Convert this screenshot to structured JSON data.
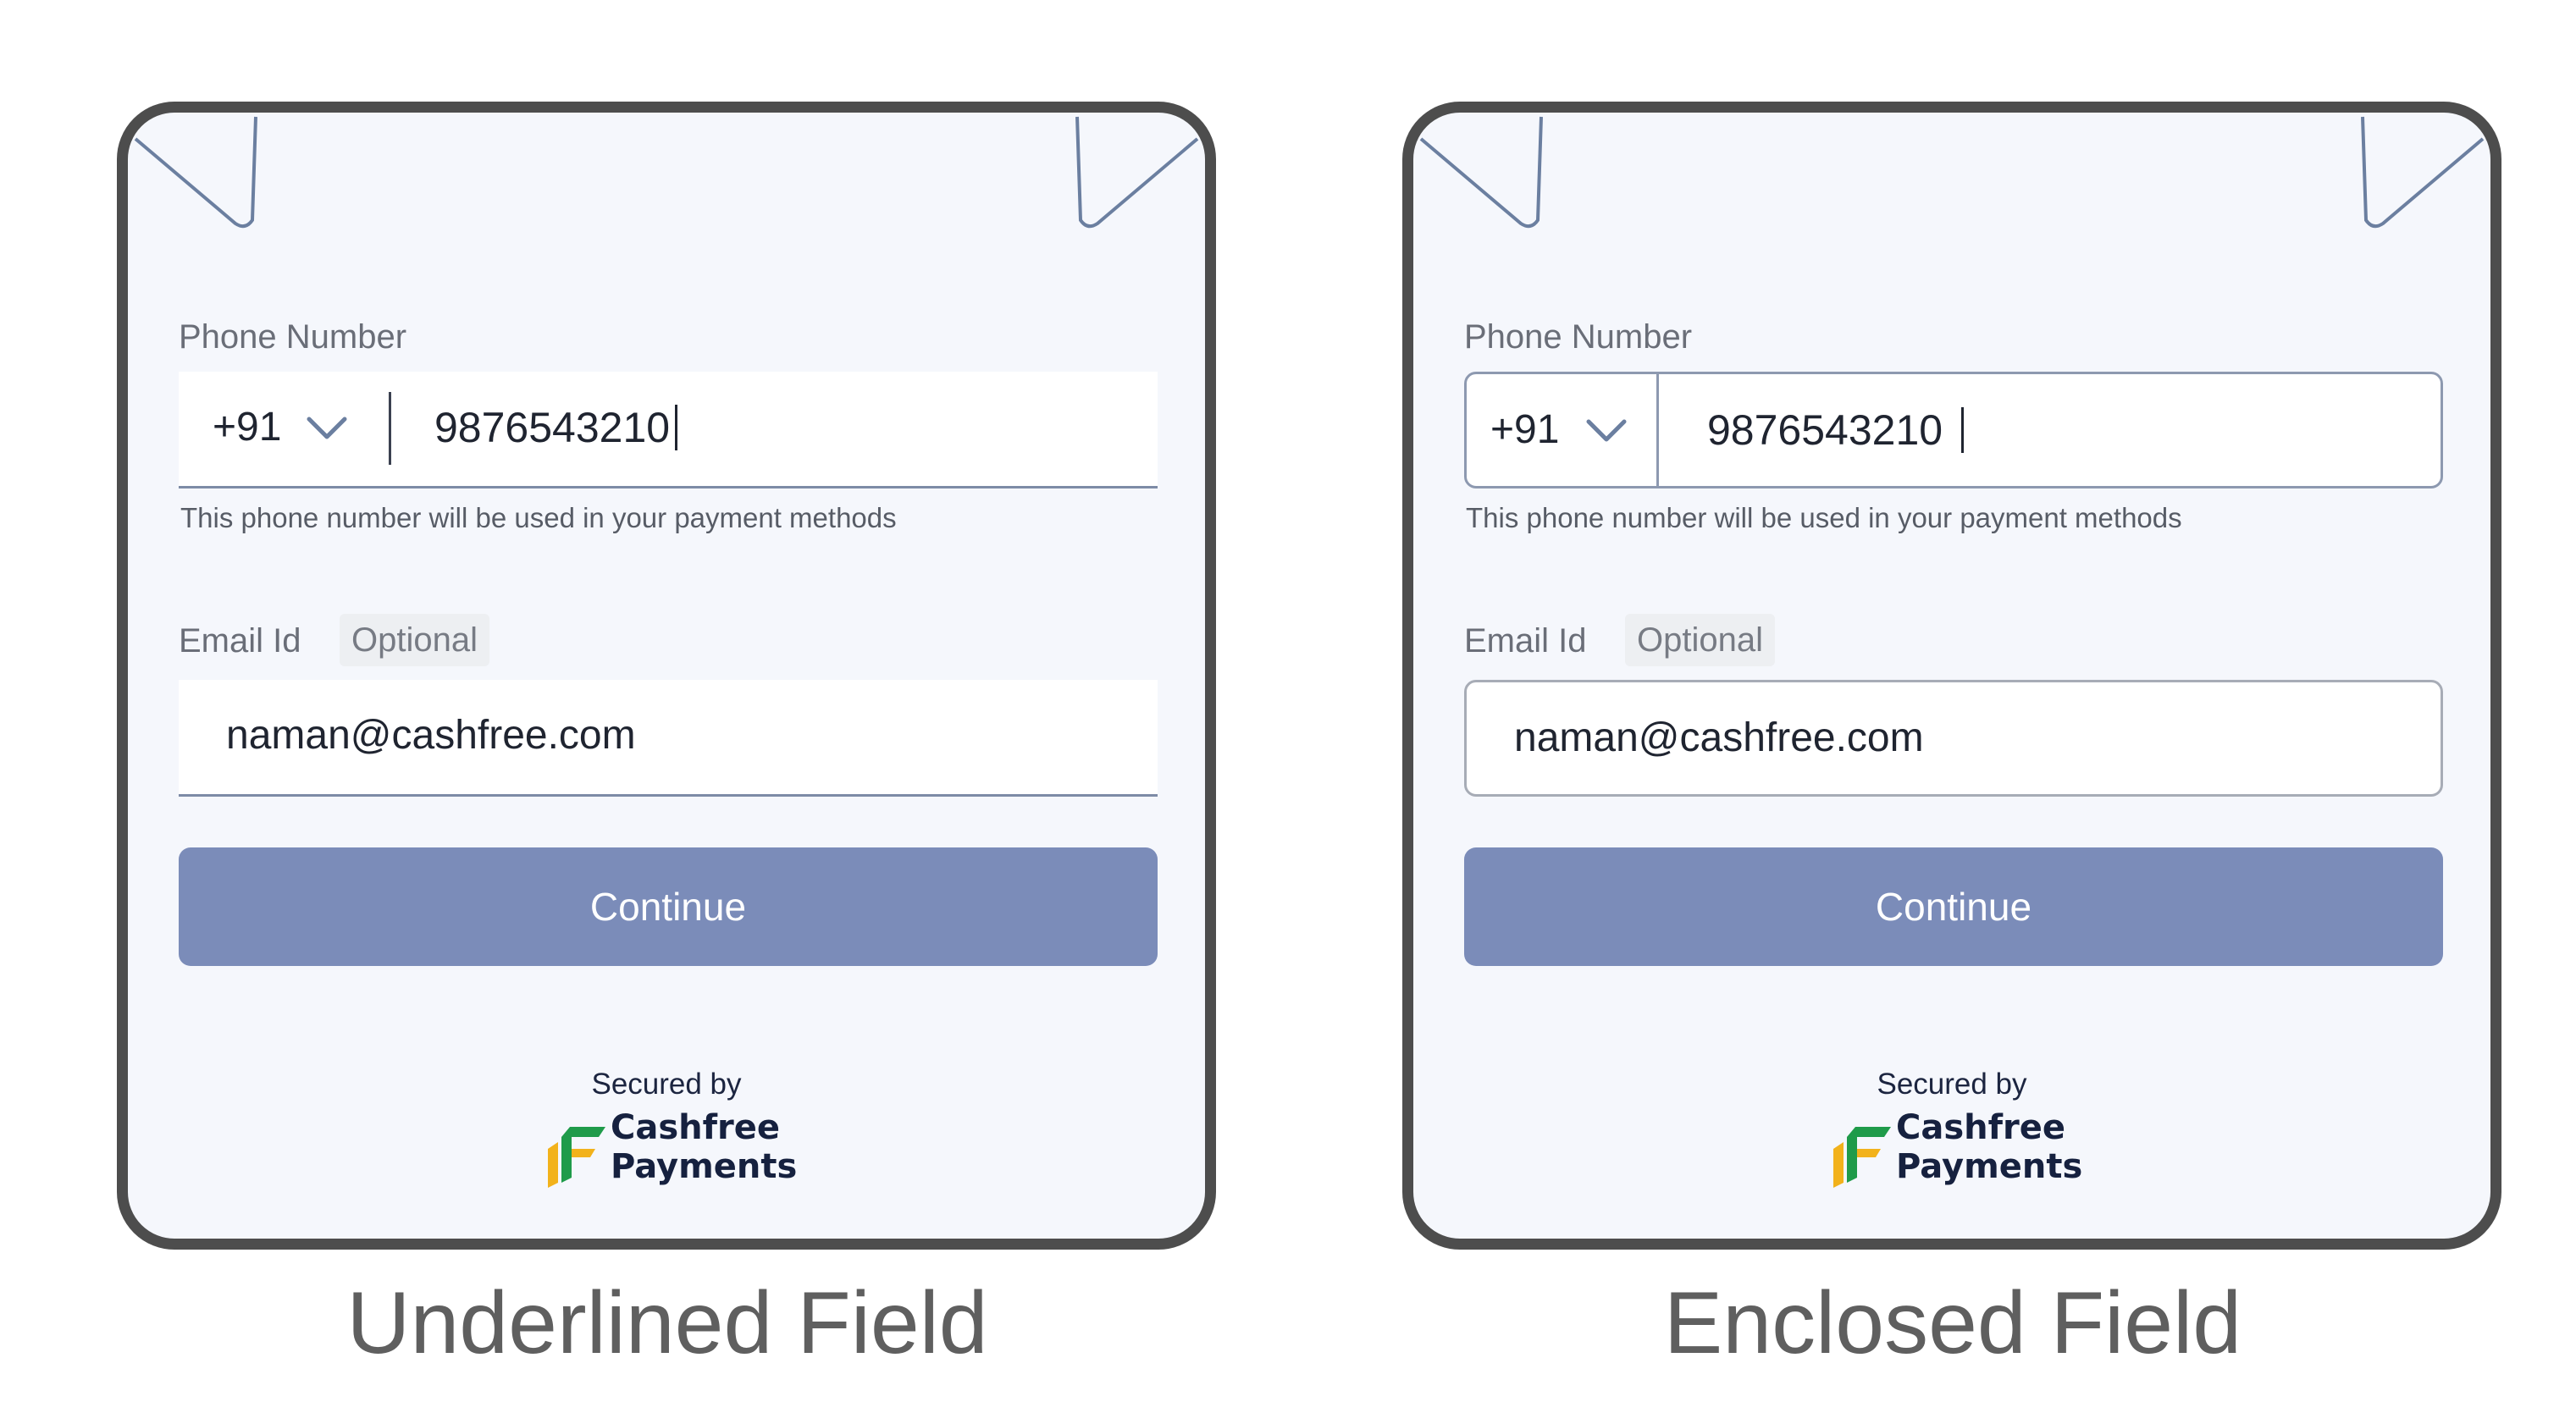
{
  "variants": [
    {
      "style": "underlined",
      "phone_label": "Phone Number",
      "country_code": "+91",
      "phone_value": "9876543210",
      "phone_helper": "This phone number will be used in your payment methods",
      "email_label": "Email Id",
      "email_optional": "Optional",
      "email_value": "naman@cashfree.com",
      "continue_label": "Continue",
      "secured_by": "Secured by",
      "brand_line1": "Cashfree",
      "brand_line2": "Payments",
      "caption": "Underlined Field"
    },
    {
      "style": "enclosed",
      "phone_label": "Phone Number",
      "country_code": "+91",
      "phone_value": "9876543210",
      "phone_helper": "This phone number will be used in your payment methods",
      "email_label": "Email Id",
      "email_optional": "Optional",
      "email_value": "naman@cashfree.com",
      "continue_label": "Continue",
      "secured_by": "Secured by",
      "brand_line1": "Cashfree",
      "brand_line2": "Payments",
      "caption": "Enclosed Field"
    }
  ],
  "colors": {
    "button": "#7b8cb9",
    "phone_bg": "#f5f7fc",
    "bezel": "#4d4d4d",
    "brand_green": "#1f9b4a",
    "brand_yellow": "#f2b21b",
    "brand_text": "#16213f"
  },
  "icons": {
    "country_dropdown": "chevron-down-icon",
    "brand_logo": "cashfree-logo-icon"
  }
}
